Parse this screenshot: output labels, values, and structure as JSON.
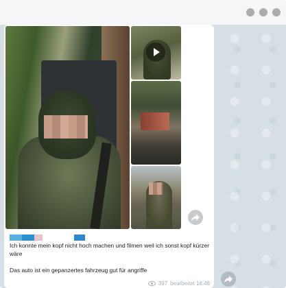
{
  "window": {
    "controls": [
      "dot",
      "dot",
      "dot"
    ]
  },
  "message": {
    "caption_line1": "Ich konnte mein  kopf nicht hoch machen und filmen weil ich sonst kopf kürzer wäre",
    "caption_line2": "Das auto ist ein gepanzertes fahrzeug gut für angriffe",
    "views": "397",
    "edited_time": "bearbeitet 16:46"
  },
  "media": {
    "items": [
      "photo",
      "video",
      "photo",
      "photo"
    ],
    "play_icon": "play-icon"
  },
  "colors": {
    "chat_background": "#d6dfe4",
    "bubble": "#ffffff",
    "meta_text": "#a7b0b6",
    "redaction_blue": "#2d8fd0",
    "redaction_light_blue": "#55aee0",
    "redaction_pink": "#e7c3cd"
  },
  "icons": {
    "share": "share-icon",
    "views": "eye-icon"
  }
}
